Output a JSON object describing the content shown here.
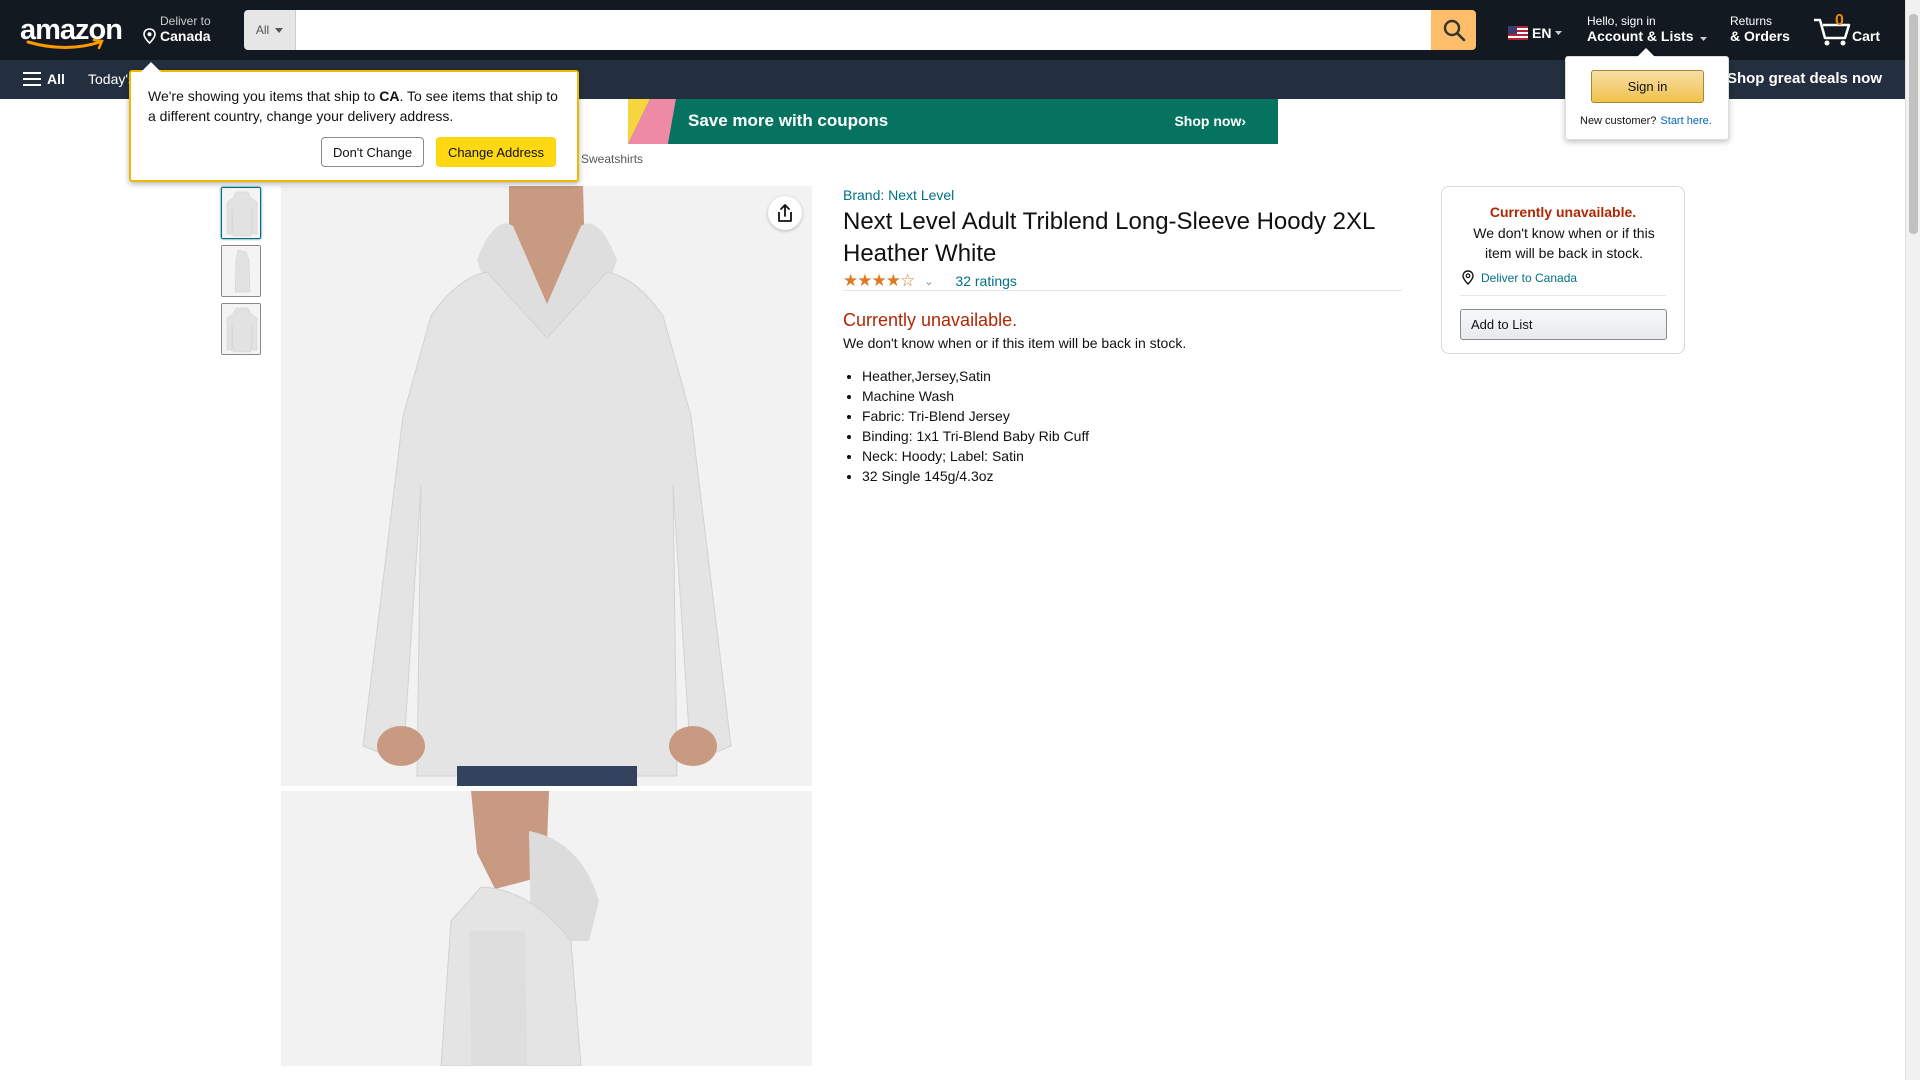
{
  "nav": {
    "logo": "amazon",
    "deliver_line1": "Deliver to",
    "deliver_line2": "Canada",
    "search_dept": "All",
    "search_placeholder": "",
    "lang": "EN",
    "account_line1": "Hello, sign in",
    "account_line2": "Account & Lists",
    "returns_line1": "Returns",
    "returns_line2": "& Orders",
    "cart_count": "0",
    "cart_label": "Cart"
  },
  "subnav": {
    "all_label": "All",
    "today": "Today's",
    "deals": "Shop great deals now"
  },
  "banner": {
    "text": "Save more with coupons",
    "cta": "Shop now›"
  },
  "breadcrumb_tail": "Sweatshirts",
  "product": {
    "brand": "Brand: Next Level",
    "title": "Next Level Adult Triblend Long-Sleeve Hoody 2XL Heather White",
    "stars": "★★★★☆",
    "rating_value": 4.0,
    "ratings": "32 ratings",
    "availability": "Currently unavailable.",
    "availability_note": "We don't know when or if this item will be back in stock.",
    "bullets": [
      "Heather,Jersey,Satin",
      "Machine Wash",
      "Fabric: Tri-Blend Jersey",
      "Binding: 1x1 Tri-Blend Baby Rib Cuff",
      "Neck: Hoody; Label: Satin",
      "32 Single 145g/4.3oz"
    ]
  },
  "buybox": {
    "availability": "Currently unavailable.",
    "note": "We don't know when or if this item will be back in stock.",
    "deliver": "Deliver to Canada",
    "add_to_list": "Add to List"
  },
  "popover": {
    "text_before": "We're showing you items that ship to ",
    "country": "CA",
    "text_after": ". To see items that ship to a different country, change your delivery address.",
    "dont_change": "Don't Change",
    "change_address": "Change Address"
  },
  "flyout": {
    "sign_in": "Sign in",
    "new_customer": "New customer?",
    "start_here": "Start here."
  },
  "colors": {
    "nav_bg": "#131921",
    "subnav_bg": "#232f3e",
    "search_btn": "#febd69",
    "link": "#007185",
    "unavailable": "#b12704",
    "star": "#de7921",
    "banner_bg": "#067360"
  },
  "icons": [
    "amazon-smile-logo",
    "location-pin-icon",
    "search-icon",
    "us-flag-icon",
    "cart-icon",
    "hamburger-icon",
    "share-icon",
    "chevron-down-icon"
  ]
}
